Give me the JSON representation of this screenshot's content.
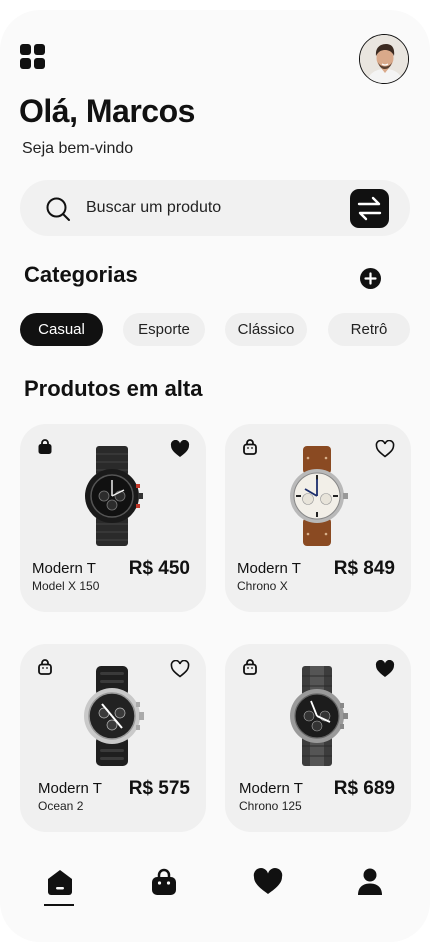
{
  "header": {
    "menu_icon": "apps-grid-icon",
    "avatar": "user-avatar"
  },
  "greeting": {
    "title": "Olá, Marcos",
    "subtitle": "Seja bem-vindo"
  },
  "search": {
    "placeholder": "Buscar um produto",
    "icon": "search-icon",
    "filter_icon": "swap-arrows-icon"
  },
  "categories": {
    "title": "Categorias",
    "add_icon": "plus-circle-icon",
    "items": [
      {
        "label": "Casual",
        "active": true
      },
      {
        "label": "Esporte",
        "active": false
      },
      {
        "label": "Clássico",
        "active": false
      },
      {
        "label": "Retrô",
        "active": false
      }
    ]
  },
  "products": {
    "title": "Produtos em alta",
    "items": [
      {
        "name": "Modern T",
        "model": "Model X 150",
        "price": "R$ 450",
        "favorite": true,
        "in_bag": true
      },
      {
        "name": "Modern T",
        "model": "Chrono X",
        "price": "R$ 849",
        "favorite": false,
        "in_bag": false
      },
      {
        "name": "Modern T",
        "model": "Ocean 2",
        "price": "R$ 575",
        "favorite": false,
        "in_bag": false
      },
      {
        "name": "Modern T",
        "model": "Chrono 125",
        "price": "R$ 689",
        "favorite": true,
        "in_bag": false
      }
    ]
  },
  "nav": {
    "items": [
      {
        "icon": "home-icon",
        "active": true
      },
      {
        "icon": "bag-icon",
        "active": false
      },
      {
        "icon": "heart-icon",
        "active": false
      },
      {
        "icon": "profile-icon",
        "active": false
      }
    ]
  },
  "colors": {
    "accent": "#111111",
    "background": "#fafafa",
    "card": "#f0f0f0",
    "watch_strap_brown": "#8a4a22"
  }
}
